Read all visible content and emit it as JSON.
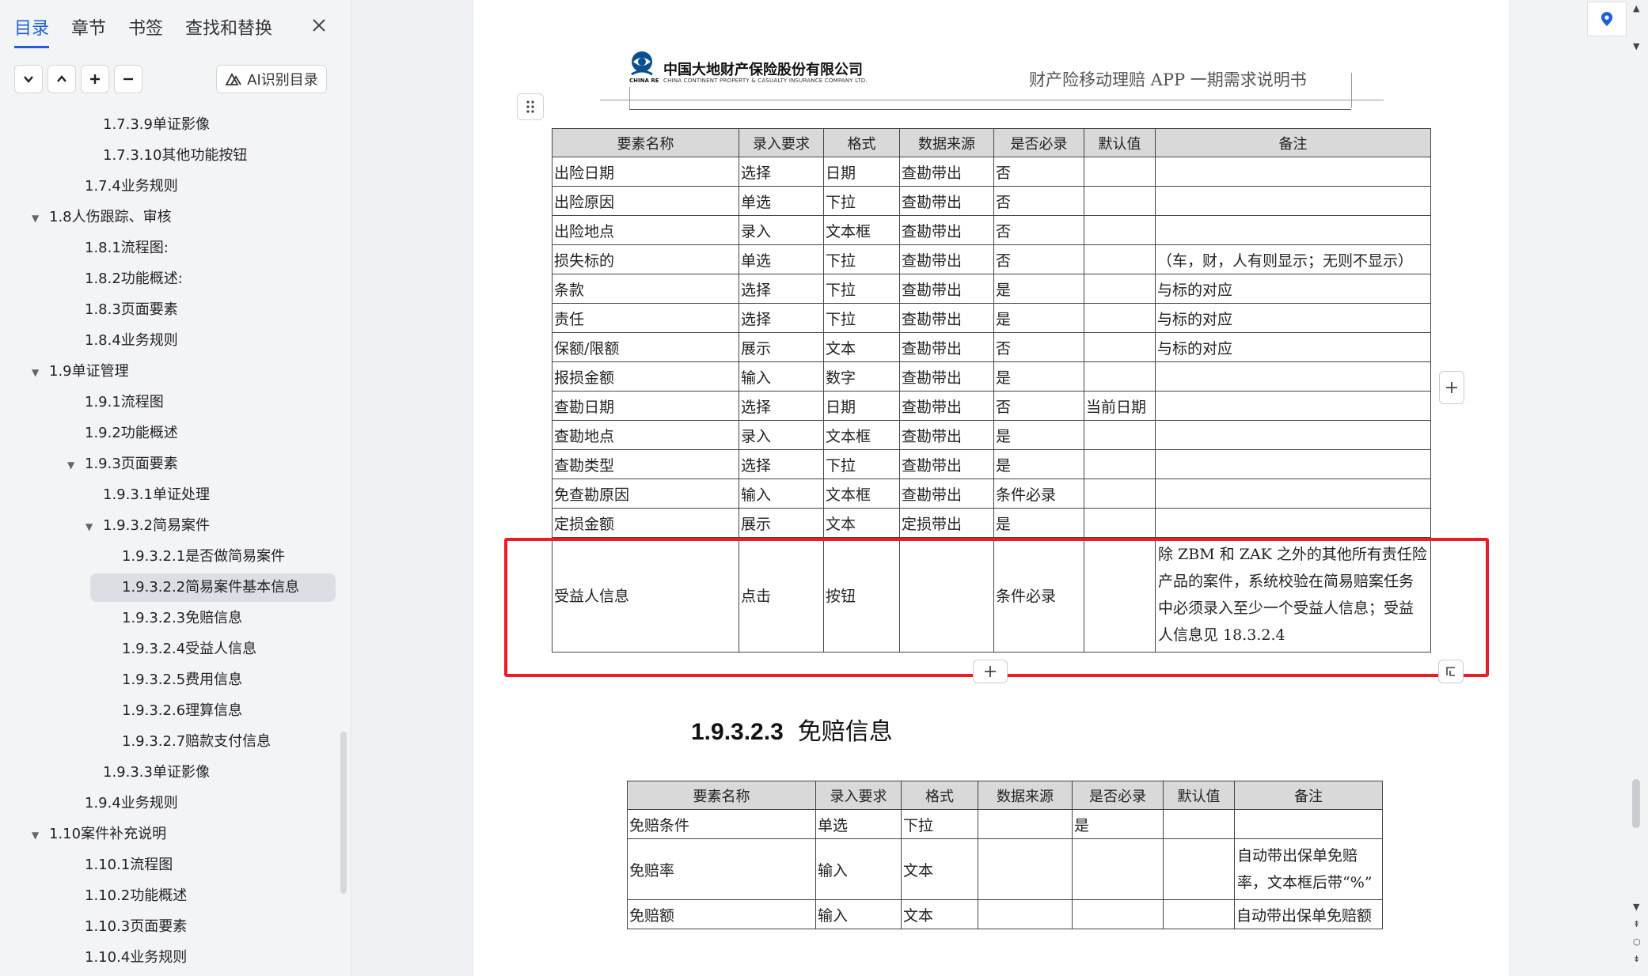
{
  "sidebar": {
    "tabs": [
      "目录",
      "章节",
      "书签",
      "查找和替换"
    ],
    "ai_button": "AI识别目录",
    "toc": [
      {
        "label": "1.7.3.9单证影像",
        "level": 3,
        "caret": ""
      },
      {
        "label": "1.7.3.10其他功能按钮",
        "level": 3,
        "caret": ""
      },
      {
        "label": "1.7.4业务规则",
        "level": 2,
        "caret": ""
      },
      {
        "label": "1.8人伤跟踪、审核",
        "level": 1,
        "caret": "▼"
      },
      {
        "label": "1.8.1流程图:",
        "level": 2,
        "caret": ""
      },
      {
        "label": "1.8.2功能概述:",
        "level": 2,
        "caret": ""
      },
      {
        "label": "1.8.3页面要素",
        "level": 2,
        "caret": ""
      },
      {
        "label": "1.8.4业务规则",
        "level": 2,
        "caret": ""
      },
      {
        "label": "1.9单证管理",
        "level": 1,
        "caret": "▼"
      },
      {
        "label": "1.9.1流程图",
        "level": 2,
        "caret": ""
      },
      {
        "label": "1.9.2功能概述",
        "level": 2,
        "caret": ""
      },
      {
        "label": "1.9.3页面要素",
        "level": 2,
        "caret": "▼"
      },
      {
        "label": "1.9.3.1单证处理",
        "level": 3,
        "caret": ""
      },
      {
        "label": "1.9.3.2简易案件",
        "level": 3,
        "caret": "▼"
      },
      {
        "label": "1.9.3.2.1是否做简易案件",
        "level": 4,
        "caret": ""
      },
      {
        "label": "1.9.3.2.2简易案件基本信息",
        "level": 4,
        "caret": "",
        "selected": true
      },
      {
        "label": "1.9.3.2.3免赔信息",
        "level": 4,
        "caret": ""
      },
      {
        "label": "1.9.3.2.4受益人信息",
        "level": 4,
        "caret": ""
      },
      {
        "label": "1.9.3.2.5费用信息",
        "level": 4,
        "caret": ""
      },
      {
        "label": "1.9.3.2.6理算信息",
        "level": 4,
        "caret": ""
      },
      {
        "label": "1.9.3.2.7赔款支付信息",
        "level": 4,
        "caret": ""
      },
      {
        "label": "1.9.3.3单证影像",
        "level": 3,
        "caret": ""
      },
      {
        "label": "1.9.4业务规则",
        "level": 2,
        "caret": ""
      },
      {
        "label": "1.10案件补充说明",
        "level": 1,
        "caret": "▼"
      },
      {
        "label": "1.10.1流程图",
        "level": 2,
        "caret": ""
      },
      {
        "label": "1.10.2功能概述",
        "level": 2,
        "caret": ""
      },
      {
        "label": "1.10.3页面要素",
        "level": 2,
        "caret": ""
      },
      {
        "label": "1.10.4业务规则",
        "level": 2,
        "caret": ""
      }
    ]
  },
  "header": {
    "company_cn": "中国大地财产保险股份有限公司",
    "company_en": "CHINA CONTINENT PROPERTY & CASUALTY INSURANCE COMPANY LTD.",
    "chinare": "CHINA RE",
    "doc_title": "财产险移动理赔 APP 一期需求说明书"
  },
  "table1": {
    "columns": [
      "要素名称",
      "录入要求",
      "格式",
      "数据来源",
      "是否必录",
      "默认值",
      "备注"
    ],
    "rows": [
      [
        "出险日期",
        "选择",
        "日期",
        "查勘带出",
        "否",
        "",
        ""
      ],
      [
        "出险原因",
        "单选",
        "下拉",
        "查勘带出",
        "否",
        "",
        ""
      ],
      [
        "出险地点",
        "录入",
        "文本框",
        "查勘带出",
        "否",
        "",
        ""
      ],
      [
        "损失标的",
        "单选",
        "下拉",
        "查勘带出",
        "否",
        "",
        "（车，财，人有则显示；无则不显示）"
      ],
      [
        "条款",
        "选择",
        "下拉",
        "查勘带出",
        "是",
        "",
        "与标的对应"
      ],
      [
        "责任",
        "选择",
        "下拉",
        "查勘带出",
        "是",
        "",
        "与标的对应"
      ],
      [
        "保额/限额",
        "展示",
        "文本",
        "查勘带出",
        "否",
        "",
        "与标的对应"
      ],
      [
        "报损金额",
        "输入",
        "数字",
        "查勘带出",
        "是",
        "",
        ""
      ],
      [
        "查勘日期",
        "选择",
        "日期",
        "查勘带出",
        "否",
        "当前日期",
        ""
      ],
      [
        "查勘地点",
        "录入",
        "文本框",
        "查勘带出",
        "是",
        "",
        ""
      ],
      [
        "查勘类型",
        "选择",
        "下拉",
        "查勘带出",
        "是",
        "",
        ""
      ],
      [
        "免查勘原因",
        "输入",
        "文本框",
        "查勘带出",
        "条件必录",
        "",
        ""
      ],
      [
        "定损金额",
        "展示",
        "文本",
        "定损带出",
        "是",
        "",
        ""
      ],
      [
        "受益人信息",
        "点击",
        "按钮",
        "",
        "条件必录",
        "",
        "除 ZBM 和 ZAK 之外的其他所有责任险产品的案件，系统校验在简易赔案任务中必须录入至少一个受益人信息；受益人信息见 18.3.2.4"
      ]
    ]
  },
  "section": {
    "number": "1.9.3.2.3",
    "title": "免赔信息"
  },
  "table2": {
    "columns": [
      "要素名称",
      "录入要求",
      "格式",
      "数据来源",
      "是否必录",
      "默认值",
      "备注"
    ],
    "rows": [
      [
        "免赔条件",
        "单选",
        "下拉",
        "",
        "是",
        "",
        ""
      ],
      [
        "免赔率",
        "输入",
        "文本",
        "",
        "",
        "",
        "自动带出保单免赔率，文本框后带“%”"
      ],
      [
        "免赔额",
        "输入",
        "文本",
        "",
        "",
        "",
        "自动带出保单免赔额"
      ]
    ]
  },
  "colors": {
    "accent": "#1f5fd6",
    "highlight_box": "#ec1c24",
    "table_header_bg": "#d9d9d9"
  }
}
